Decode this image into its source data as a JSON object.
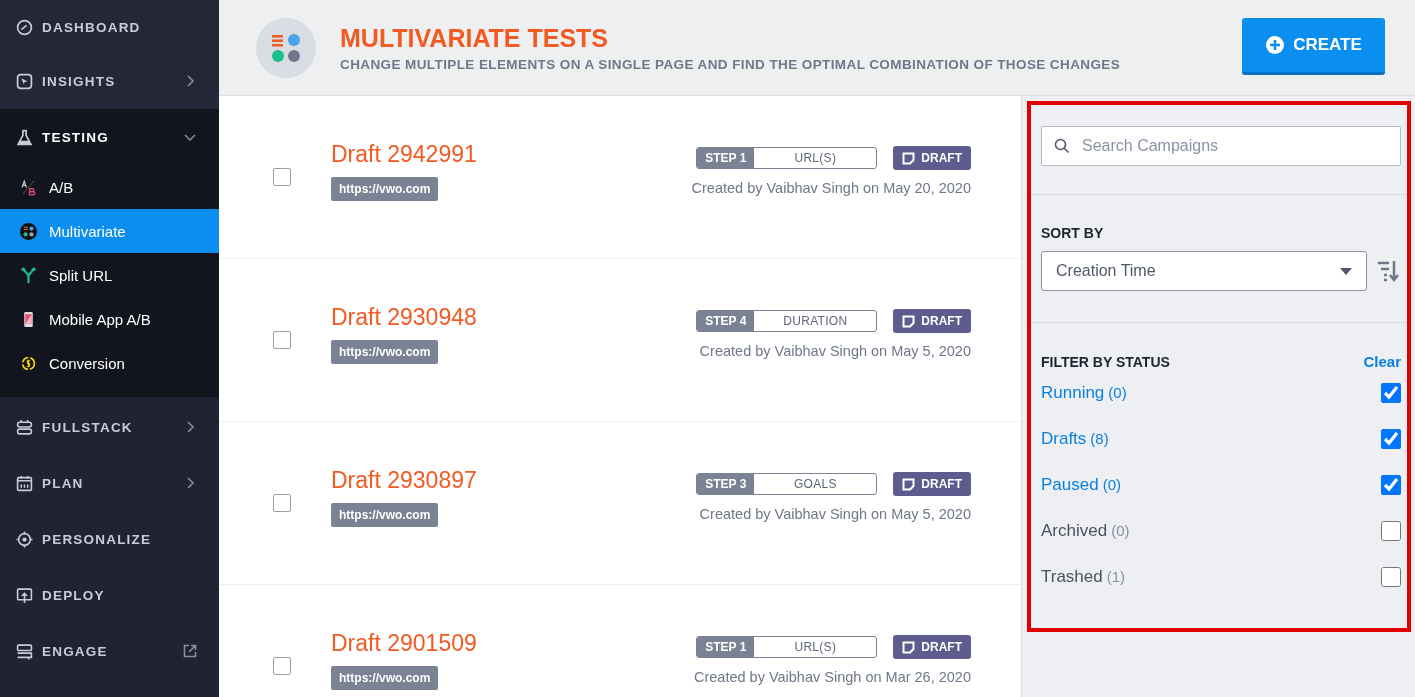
{
  "sidebar": {
    "items": [
      {
        "label": "DASHBOARD",
        "kind": "plain"
      },
      {
        "label": "INSIGHTS",
        "kind": "submenu"
      },
      {
        "label": "TESTING",
        "kind": "expandable",
        "expanded": true,
        "children": [
          {
            "label": "A/B",
            "selected": false
          },
          {
            "label": "Multivariate",
            "selected": true
          },
          {
            "label": "Split URL",
            "selected": false
          },
          {
            "label": "Mobile App A/B",
            "selected": false
          },
          {
            "label": "Conversion",
            "selected": false
          }
        ]
      },
      {
        "label": "FULLSTACK",
        "kind": "submenu"
      },
      {
        "label": "PLAN",
        "kind": "submenu"
      },
      {
        "label": "PERSONALIZE",
        "kind": "plain"
      },
      {
        "label": "DEPLOY",
        "kind": "plain"
      },
      {
        "label": "ENGAGE",
        "kind": "external"
      }
    ]
  },
  "header": {
    "title": "MULTIVARIATE TESTS",
    "subtitle": "CHANGE MULTIPLE ELEMENTS ON A SINGLE PAGE AND FIND THE OPTIMAL COMBINATION OF THOSE CHANGES",
    "create_button": "CREATE"
  },
  "campaigns": [
    {
      "title": "Draft 2942991",
      "url": "https://vwo.com",
      "step": "STEP 1",
      "step_name": "URL(S)",
      "status": "DRAFT",
      "created": "Created by Vaibhav Singh on May 20, 2020",
      "checked": false
    },
    {
      "title": "Draft 2930948",
      "url": "https://vwo.com",
      "step": "STEP 4",
      "step_name": "DURATION",
      "status": "DRAFT",
      "created": "Created by Vaibhav Singh on May 5, 2020",
      "checked": false
    },
    {
      "title": "Draft 2930897",
      "url": "https://vwo.com",
      "step": "STEP 3",
      "step_name": "GOALS",
      "status": "DRAFT",
      "created": "Created by Vaibhav Singh on May 5, 2020",
      "checked": false
    },
    {
      "title": "Draft 2901509",
      "url": "https://vwo.com",
      "step": "STEP 1",
      "step_name": "URL(S)",
      "status": "DRAFT",
      "created": "Created by Vaibhav Singh on Mar 26, 2020",
      "checked": false
    }
  ],
  "filter_panel": {
    "highlighted": true,
    "search": {
      "placeholder": "Search Campaigns"
    },
    "sort_by": {
      "label": "SORT BY",
      "value": "Creation Time"
    },
    "filter_by_status": {
      "label": "FILTER BY STATUS",
      "clear": "Clear",
      "options": [
        {
          "label": "Running",
          "count": "(0)",
          "checked": true
        },
        {
          "label": "Drafts",
          "count": "(8)",
          "checked": true
        },
        {
          "label": "Paused",
          "count": "(0)",
          "checked": true
        },
        {
          "label": "Archived",
          "count": "(0)",
          "checked": false
        },
        {
          "label": "Trashed",
          "count": "(1)",
          "checked": false
        }
      ]
    }
  }
}
